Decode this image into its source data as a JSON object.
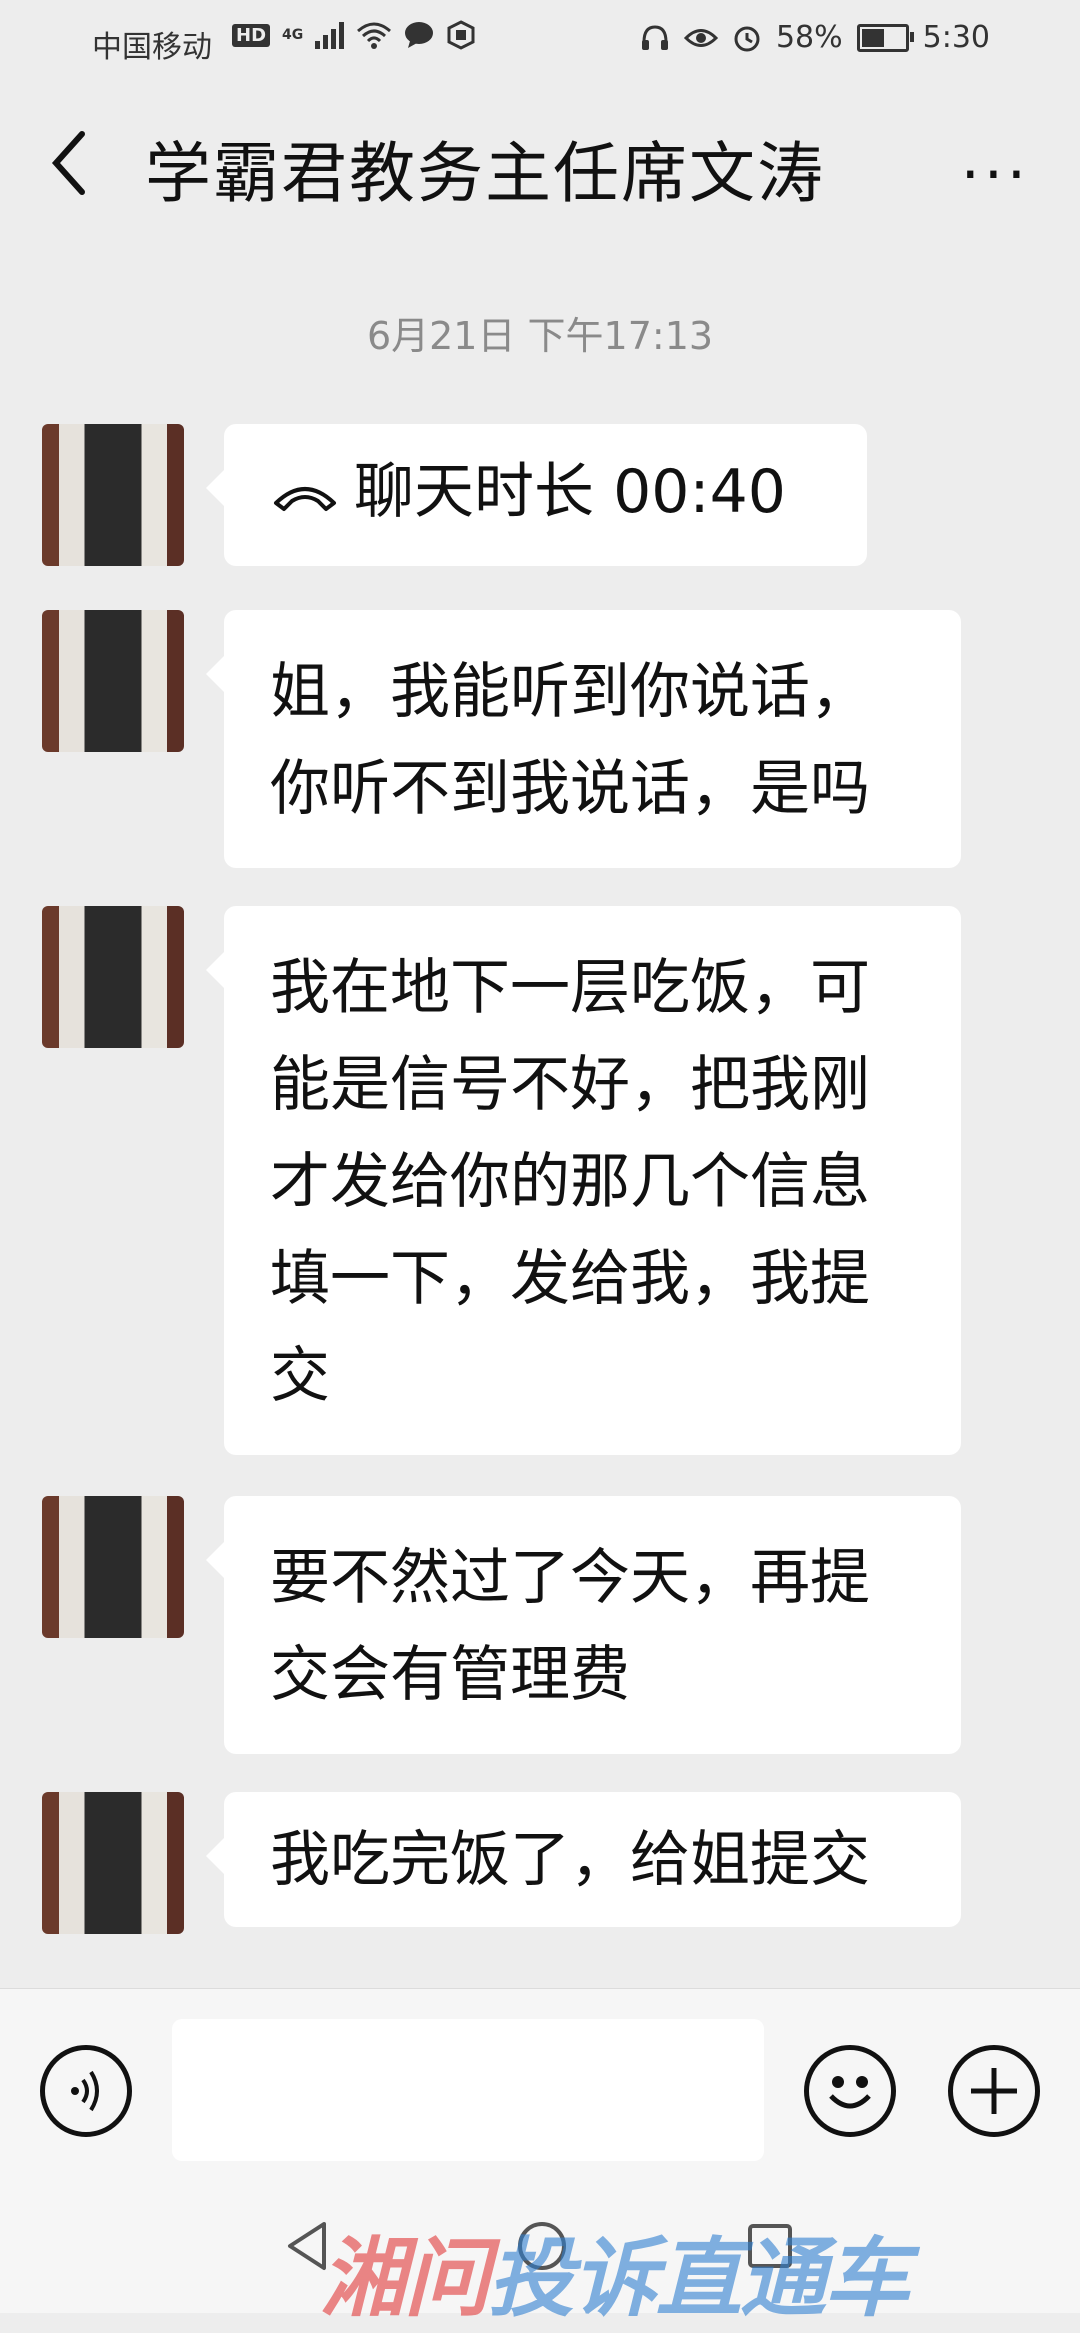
{
  "status_bar": {
    "carrier": "中国移动",
    "network_badge": "HD",
    "network_type": "4G",
    "battery_percent": "58%",
    "time": "5:30",
    "battery_level": 0.58,
    "icons": [
      "wifi-icon",
      "chat-bubble-icon",
      "hand-icon",
      "headphone-icon",
      "eye-icon",
      "alarm-icon",
      "battery-icon"
    ]
  },
  "header": {
    "title": "学霸君教务主任席文涛",
    "more_label": "···"
  },
  "chat": {
    "timestamp": "6月21日 下午17:13",
    "messages": [
      {
        "type": "call",
        "text": "聊天时长 00:40"
      },
      {
        "type": "text",
        "lines": [
          "姐，我能听到你说话，",
          "你听不到我说话，是吗"
        ]
      },
      {
        "type": "text",
        "lines": [
          "我在地下一层吃饭，可",
          "能是信号不好，把我刚",
          "才发给你的那几个信息",
          "填一下，发给我，我提",
          "交"
        ]
      },
      {
        "type": "text",
        "lines": [
          "要不然过了今天，再提",
          "交会有管理费"
        ]
      },
      {
        "type": "text",
        "lines": [
          "我吃完饭了，给姐提交"
        ]
      }
    ]
  },
  "input_bar": {
    "input_value": ""
  },
  "watermark": {
    "part1": "湘问",
    "part2": "投诉直通车"
  }
}
